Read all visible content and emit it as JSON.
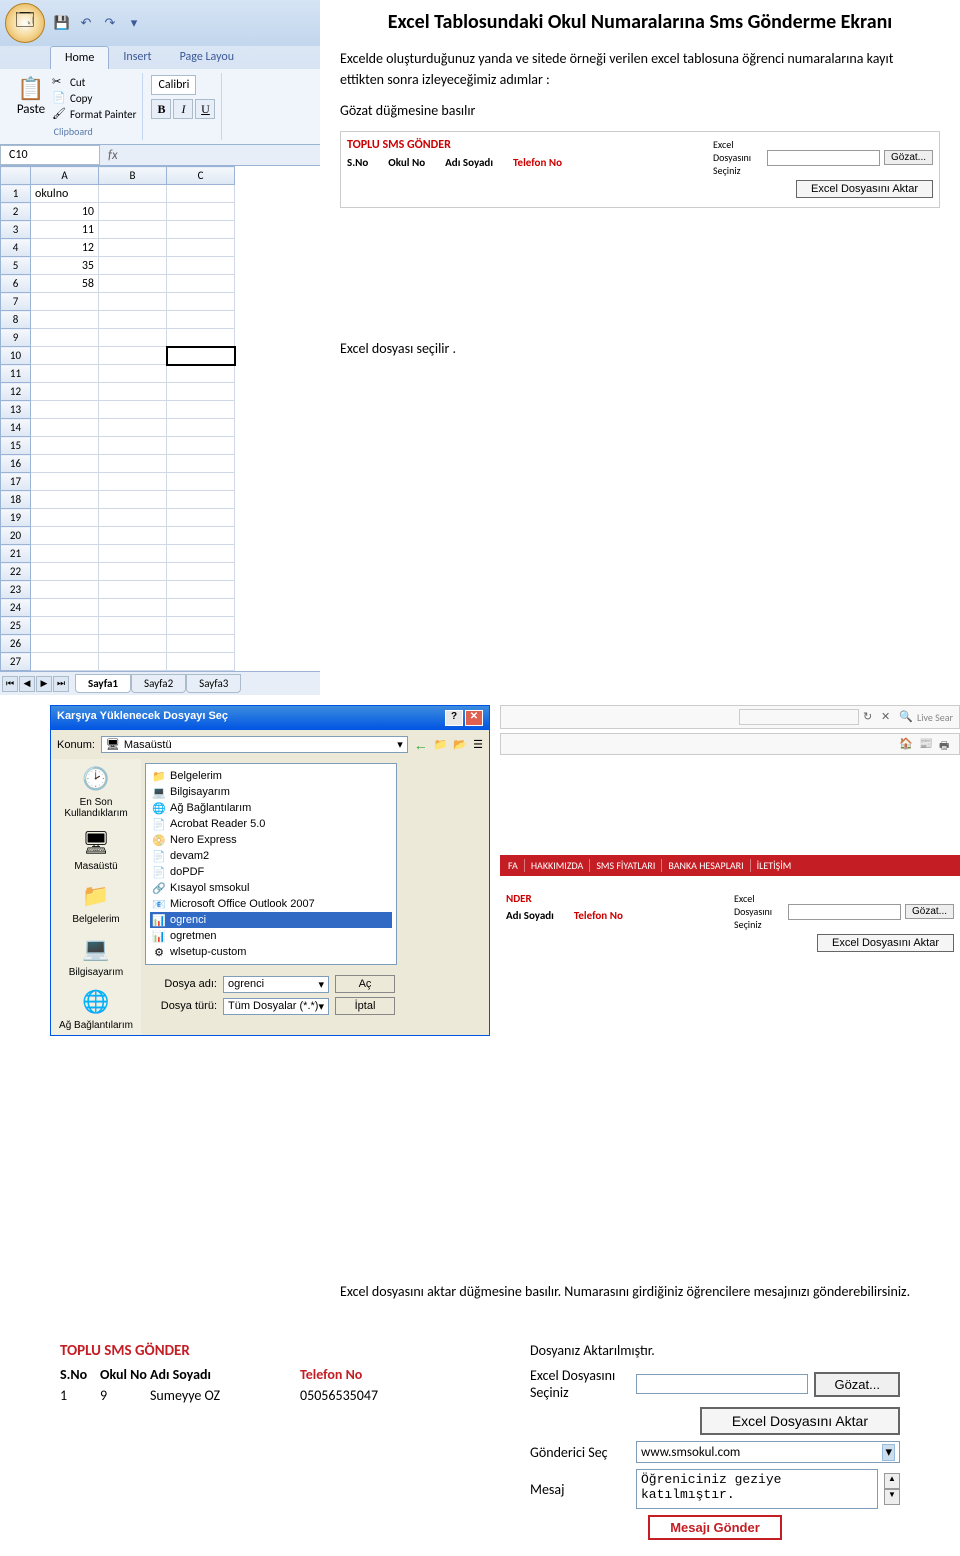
{
  "doc": {
    "title": "Excel Tablosundaki Okul Numaralarına  Sms Gönderme Ekranı",
    "p1": "Excelde oluşturduğunuz yanda ve sitede örneği verilen excel tablosuna öğrenci numaralarına kayıt ettikten sonra izleyeceğimiz adımlar :",
    "p2": "Gözat düğmesine basılır",
    "p3": "Excel dosyası seçilir .",
    "p4": "Excel dosyasını aktar düğmesine basılır. Numarasını girdiğiniz öğrencilere mesajınızı gönderebilirsiniz."
  },
  "excel": {
    "tabs": [
      "Home",
      "Insert",
      "Page Layou"
    ],
    "paste": "Paste",
    "cut": "Cut",
    "copy": "Copy",
    "fpaint": "Format Painter",
    "clipboard": "Clipboard",
    "font": "Calibri",
    "namebox": "C10",
    "cols": [
      "A",
      "B",
      "C"
    ],
    "rows": [
      {
        "n": "1",
        "a": "okulno",
        "b": "",
        "c": ""
      },
      {
        "n": "2",
        "a": "10",
        "b": "",
        "c": ""
      },
      {
        "n": "3",
        "a": "11",
        "b": "",
        "c": ""
      },
      {
        "n": "4",
        "a": "12",
        "b": "",
        "c": ""
      },
      {
        "n": "5",
        "a": "35",
        "b": "",
        "c": ""
      },
      {
        "n": "6",
        "a": "58",
        "b": "",
        "c": ""
      },
      {
        "n": "7",
        "a": "",
        "b": "",
        "c": ""
      },
      {
        "n": "8",
        "a": "",
        "b": "",
        "c": ""
      },
      {
        "n": "9",
        "a": "",
        "b": "",
        "c": ""
      },
      {
        "n": "10",
        "a": "",
        "b": "",
        "c": ""
      },
      {
        "n": "11",
        "a": "",
        "b": "",
        "c": ""
      },
      {
        "n": "12",
        "a": "",
        "b": "",
        "c": ""
      },
      {
        "n": "13",
        "a": "",
        "b": "",
        "c": ""
      },
      {
        "n": "14",
        "a": "",
        "b": "",
        "c": ""
      },
      {
        "n": "15",
        "a": "",
        "b": "",
        "c": ""
      },
      {
        "n": "16",
        "a": "",
        "b": "",
        "c": ""
      },
      {
        "n": "17",
        "a": "",
        "b": "",
        "c": ""
      },
      {
        "n": "18",
        "a": "",
        "b": "",
        "c": ""
      },
      {
        "n": "19",
        "a": "",
        "b": "",
        "c": ""
      },
      {
        "n": "20",
        "a": "",
        "b": "",
        "c": ""
      },
      {
        "n": "21",
        "a": "",
        "b": "",
        "c": ""
      },
      {
        "n": "22",
        "a": "",
        "b": "",
        "c": ""
      },
      {
        "n": "23",
        "a": "",
        "b": "",
        "c": ""
      },
      {
        "n": "24",
        "a": "",
        "b": "",
        "c": ""
      },
      {
        "n": "25",
        "a": "",
        "b": "",
        "c": ""
      },
      {
        "n": "26",
        "a": "",
        "b": "",
        "c": ""
      },
      {
        "n": "27",
        "a": "",
        "b": "",
        "c": ""
      }
    ],
    "sheets": [
      "Sayfa1",
      "Sayfa2",
      "Sayfa3"
    ]
  },
  "sms1": {
    "title": "TOPLU SMS GÖNDER",
    "h_sno": "S.No",
    "h_okul": "Okul No",
    "h_ad": "Adı Soyadı",
    "h_tel": "Telefon No",
    "lbl_excel": "Excel Dosyasını Seçiniz",
    "btn_gozat": "Gözat...",
    "btn_aktar": "Excel Dosyasını Aktar"
  },
  "dialog": {
    "title": "Karşıya Yüklenecek Dosyayı Seç",
    "konum": "Konum:",
    "konum_val": "Masaüstü",
    "places": [
      "En Son Kullandıklarım",
      "Masaüstü",
      "Belgelerim",
      "Bilgisayarım",
      "Ağ Bağlantılarım"
    ],
    "files": [
      "Belgelerim",
      "Bilgisayarım",
      "Ağ Bağlantılarım",
      "Acrobat Reader 5.0",
      "Nero Express",
      "devam2",
      "doPDF",
      "Kısayol smsokul",
      "Microsoft Office Outlook 2007",
      "ogrenci",
      "ogretmen",
      "wlsetup-custom"
    ],
    "dosya_adi_lbl": "Dosya adı:",
    "dosya_adi": "ogrenci",
    "dosya_turu_lbl": "Dosya türü:",
    "dosya_turu": "Tüm Dosyalar (*.*)",
    "ac": "Aç",
    "iptal": "İptal"
  },
  "rednav": [
    "FA",
    "HAKKIMIZDA",
    "SMS FİYATLARI",
    "BANKA HESAPLARI",
    "İLETİŞİM"
  ],
  "sms2": {
    "hdr": "NDER",
    "h_ad": "Adı Soyadı",
    "h_tel": "Telefon No",
    "lbl_excel": "Excel Dosyasını Seçiniz",
    "btn_gozat": "Gözat...",
    "btn_aktar": "Excel Dosyasını Aktar"
  },
  "bottom": {
    "title": "TOPLU SMS GÖNDER",
    "h_sno": "S.No",
    "h_okul": "Okul No",
    "h_ad": "Adı Soyadı",
    "h_tel": "Telefon No",
    "r_sno": "1",
    "r_okul": "9",
    "r_ad": "Sumeyye OZ",
    "r_tel": "05056535047",
    "status": "Dosyanız Aktarılmıştır.",
    "lbl_excel": "Excel Dosyasını Seçiniz",
    "btn_gozat": "Gözat...",
    "btn_aktar": "Excel Dosyasını Aktar",
    "lbl_gonderici": "Gönderici Seç",
    "gonderici": "www.smsokul.com",
    "lbl_mesaj": "Mesaj",
    "mesaj": "Öğreniciniz geziye katılmıştır.",
    "btn_send": "Mesajı Gönder"
  },
  "live": "Live Sear"
}
